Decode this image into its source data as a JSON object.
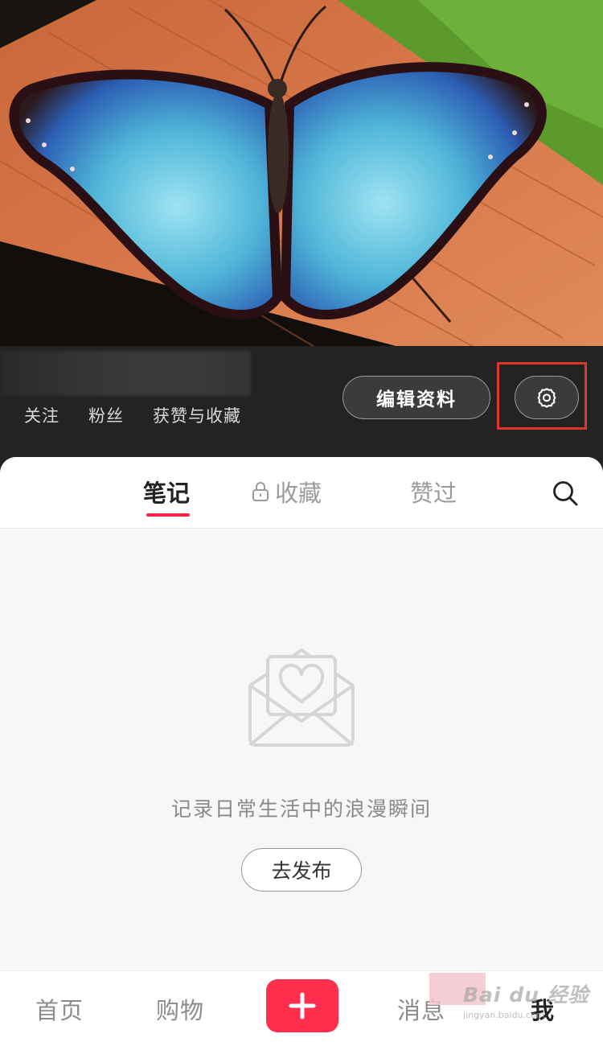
{
  "profile": {
    "stats": [
      "关注",
      "粉丝",
      "获赞与收藏"
    ],
    "edit_label": "编辑资料"
  },
  "tabs": {
    "notes": "笔记",
    "collections": "收藏",
    "liked": "赞过"
  },
  "empty_state": {
    "text": "记录日常生活中的浪漫瞬间",
    "button": "去发布"
  },
  "bottom_nav": {
    "home": "首页",
    "shop": "购物",
    "messages": "消息",
    "me": "我"
  },
  "watermark": {
    "main": "Bai du 经验",
    "sub": "jingyan.baidu.com"
  },
  "icons": {
    "settings": "gear-icon",
    "lock": "lock-icon",
    "search": "search-icon",
    "empty": "envelope-heart-icon",
    "plus": "plus-icon"
  },
  "colors": {
    "accent": "#ff2442",
    "highlight": "#e1362b",
    "dark_band": "#232323"
  }
}
